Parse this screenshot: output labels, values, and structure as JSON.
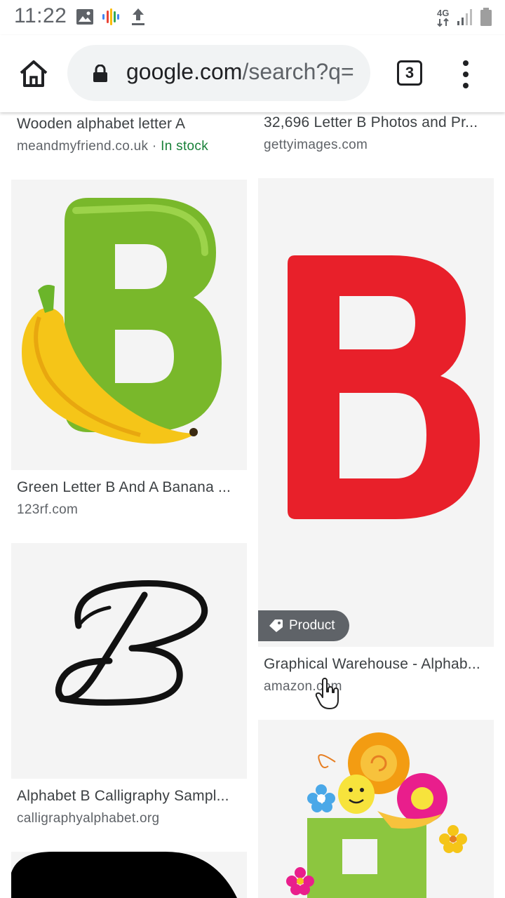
{
  "status_bar": {
    "time": "11:22",
    "network_type": "4G",
    "icons": [
      "gallery-icon",
      "google-assistant-icon",
      "upload-icon",
      "signal-icon",
      "battery-icon"
    ]
  },
  "browser": {
    "url_domain": "google.com",
    "url_rest": "/search?q=",
    "tab_count": "3"
  },
  "results": [
    {
      "title": "Wooden alphabet letter A",
      "source": "meandmyfriend.co.uk",
      "separator": " · ",
      "stock": "In stock"
    },
    {
      "title": "32,696 Letter B Photos and Pr...",
      "source": "gettyimages.com"
    },
    {
      "title": "Green Letter B And A Banana ...",
      "source": "123rf.com"
    },
    {
      "title": "Graphical Warehouse - Alphab...",
      "source": "amazon.com",
      "badge": "Product"
    },
    {
      "title": "Alphabet B Calligraphy Sampl...",
      "source": "calligraphyalphabet.org"
    }
  ],
  "colors": {
    "stock_green": "#188038",
    "red_letter": "#e8202a",
    "green_letter": "#78b82a",
    "banana_yellow": "#f5c518",
    "badge_gray": "#5f6368"
  }
}
